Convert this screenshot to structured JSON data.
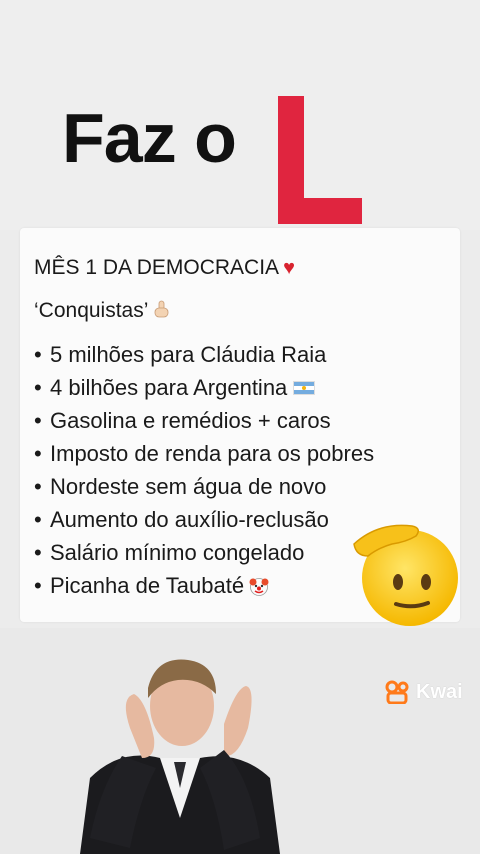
{
  "header": {
    "title_text": "Faz o",
    "title_letter": "L",
    "letter_color": "#e0253f"
  },
  "card": {
    "title": "MÊS 1 DA DEMOCRACIA",
    "title_emoji": "❤️",
    "subtitle": "‘Conquistas’",
    "subtitle_icon": "pointing-down-icon",
    "items": [
      {
        "text": "5 milhões para Cláudia Raia"
      },
      {
        "text": "4 bilhões para Argentina",
        "icon": "argentina-flag-icon"
      },
      {
        "text": "Gasolina e remédios + caros"
      },
      {
        "text": "Imposto de renda para os pobres"
      },
      {
        "text": "Nordeste sem água de novo"
      },
      {
        "text": "Aumento do auxílio-reclusão"
      },
      {
        "text": "Salário mínimo congelado"
      },
      {
        "text": "Picanha de Taubaté",
        "icon": "clown-face-icon"
      }
    ],
    "bullet": "•"
  },
  "overlay": {
    "emoji": "saluting-face-icon"
  },
  "footer": {
    "watermark": "Kwai",
    "watermark_icon": "kwai-camera-icon"
  }
}
